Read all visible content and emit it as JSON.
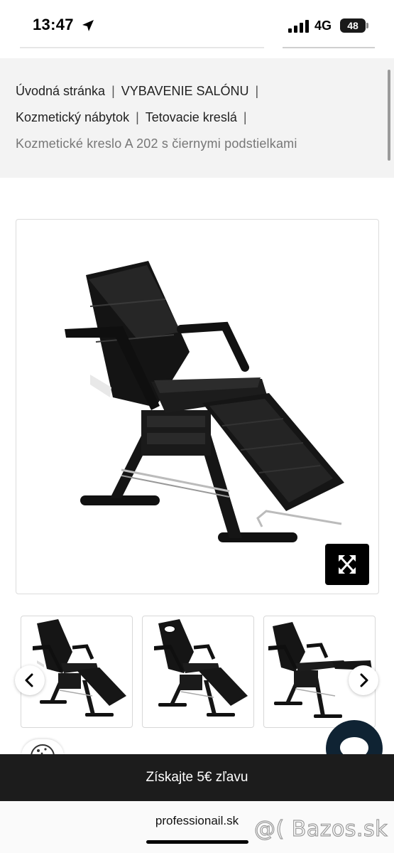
{
  "status_bar": {
    "time": "13:47",
    "network": "4G",
    "battery": "48"
  },
  "breadcrumb": {
    "items": [
      "Úvodná stránka",
      "VYBAVENIE SALÓNU",
      "Kozmetický nábytok",
      "Tetovacie kreslá"
    ],
    "separator": "|",
    "current": "Kozmetické kreslo A 202 s čiernymi podstielkami"
  },
  "promo": {
    "text": "Získajte 5€ zľavu"
  },
  "url_bar": {
    "domain": "professionail.sk"
  },
  "watermark": "@( Bazos.sk",
  "colors": {
    "promo_bg": "#1c1c1c",
    "chat_bg": "#0f2333",
    "breadcrumb_bg": "#f3f3f3"
  },
  "icons": [
    "location-arrow-icon",
    "signal-icon",
    "battery-icon",
    "expand-icon",
    "chevron-left-icon",
    "chevron-right-icon",
    "chat-icon",
    "cookie-icon"
  ]
}
